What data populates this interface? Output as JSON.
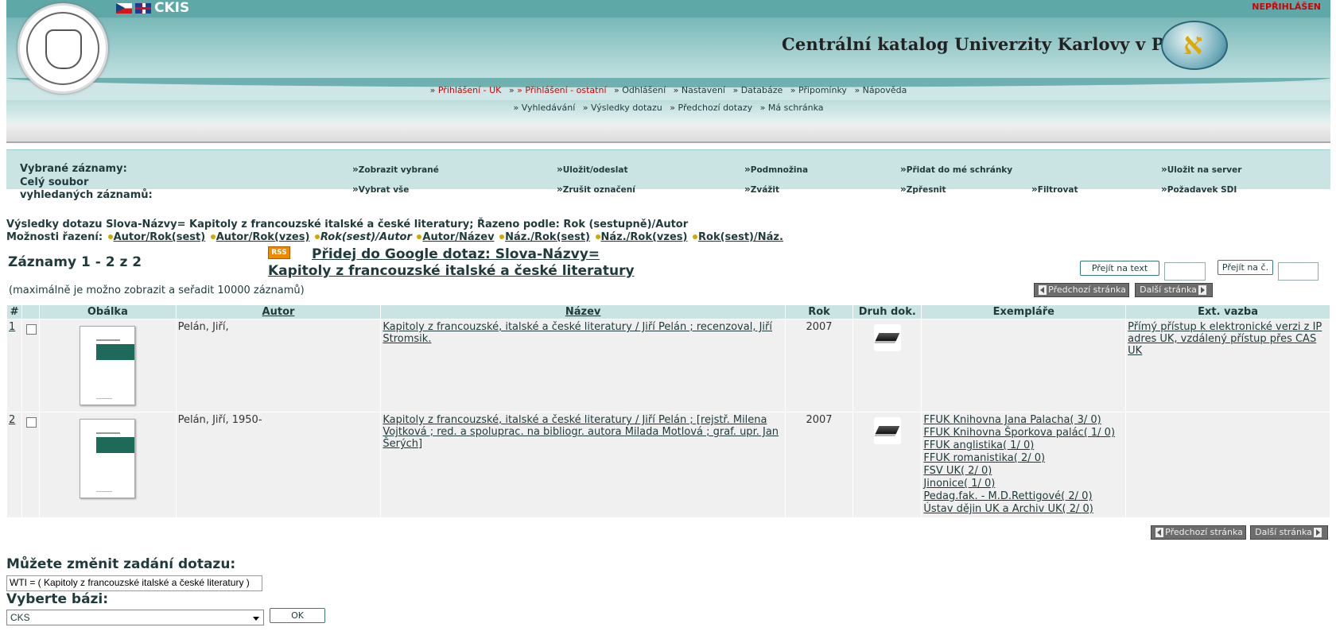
{
  "header": {
    "brand": "CKIS",
    "login_status": "NEPŘIHLÁŠEN",
    "catalog_title": "Centrální katalog Univerzity  Karlovy v Praze",
    "menu1": [
      {
        "label": "Přihlášení - UK",
        "red": true
      },
      {
        "label": "» Přihlášení - ostatní",
        "red": true
      },
      {
        "label": "Odhlášení",
        "red": false
      },
      {
        "label": "Nastavení",
        "red": false
      },
      {
        "label": "Databáze",
        "red": false
      },
      {
        "label": "Připomínky",
        "red": false
      },
      {
        "label": "Nápověda",
        "red": false
      }
    ],
    "menu2": [
      "Vyhledávání",
      "Výsledky dotazu",
      "Předchozí dotazy",
      "Má schránka"
    ]
  },
  "toolbar": {
    "selected_label": "Vybrané záznamy:",
    "whole_label_1": "Celý soubor",
    "whole_label_2": "vyhledaných záznamů:",
    "row1": [
      "Zobrazit vybrané",
      "Uložit/odeslat",
      "Podmnožina",
      "Přidat do mé schránky",
      "Uložit na server"
    ],
    "row2": [
      "Vybrat vše",
      "Zrušit označení",
      "Zvážit",
      "Zpřesnit",
      "Filtrovat",
      "Požadavek SDI"
    ]
  },
  "query": {
    "summary": "Výsledky dotazu Slova-Názvy= Kapitoly z francouzské italské a české literatury; Řazeno podle: Rok (sestupně)/Autor",
    "sort_label": "Možnosti řazení:",
    "sort_options": [
      "Autor/Rok(sest)",
      "Autor/Rok(vzes)",
      "Rok(sest)/Autor",
      "Autor/Název",
      "Náz./Rok(sest)",
      "Náz./Rok(vzes)",
      "Rok(sest)/Náz."
    ],
    "records": "Záznamy 1 - 2 z 2",
    "rss": "RSS",
    "google_link": "Přidej do Google dotaz: Slova-Názvy= Kapitoly z francouzské italské a české literatury",
    "max_note": "(maximálně je možno zobrazit a seřadit 10000 záznamů)",
    "goto_text": "Přejít na text",
    "goto_num": "Přejít na č.",
    "prev_page": "Předchozí stránka",
    "next_page": "Další stránka"
  },
  "table": {
    "headers": [
      "#",
      "",
      "Obálka",
      "Autor",
      "Název",
      "Rok",
      "Druh dok.",
      "Exempláře",
      "Ext. vazba"
    ],
    "rows": [
      {
        "num": "1",
        "author": "Pelán, Jiří,",
        "title": "Kapitoly z francouzské, italské a české literatury / Jiří Pelán ; recenzoval, Jiří Stromsik.",
        "year": "2007",
        "copies": [],
        "ext": "Přímý přístup k elektronické verzi z IP adres UK, vzdálený přístup přes CAS UK "
      },
      {
        "num": "2",
        "author": "Pelán, Jiří, 1950-",
        "title": "Kapitoly z francouzské, italské a české literatury / Jiří Pelán ; [rejstř. Milena Vojtková ; red. a spoluprac. na bibliogr. autora Milada Motlová ; graf. upr. Jan Šerých]",
        "year": "2007",
        "copies": [
          "FFUK Knihovna Jana Palacha( 3/ 0)",
          "FFUK Knihovna Šporkova palác( 1/ 0)",
          "FFUK anglistika( 1/ 0)",
          "FFUK romanistika( 2/ 0)",
          "FSV UK( 2/ 0)",
          "Jinonice( 1/ 0)",
          "Pedag.fak. - M.D.Rettigové( 2/ 0)",
          "Ústav dějin UK a Archiv UK( 2/ 0)"
        ],
        "ext": ""
      }
    ]
  },
  "bottom": {
    "change_label": "Můžete změnit zadání dotazu:",
    "query_value": "WTI = ( Kapitoly z francouzské italské a české literatury )",
    "base_label": "Vyberte bázi:",
    "base_value": "CKS",
    "ok": "OK"
  }
}
